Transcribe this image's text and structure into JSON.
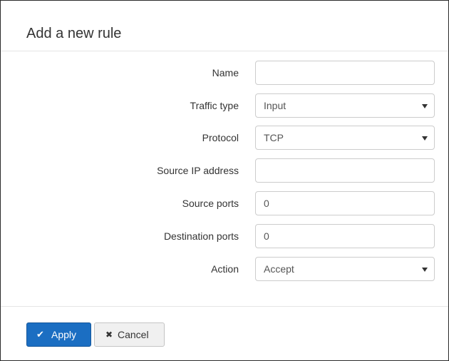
{
  "dialog": {
    "title": "Add a new rule"
  },
  "form": {
    "name": {
      "label": "Name",
      "value": ""
    },
    "traffic_type": {
      "label": "Traffic type",
      "value": "Input"
    },
    "protocol": {
      "label": "Protocol",
      "value": "TCP"
    },
    "source_ip": {
      "label": "Source IP address",
      "value": ""
    },
    "source_ports": {
      "label": "Source ports",
      "value": "0"
    },
    "destination_ports": {
      "label": "Destination ports",
      "value": "0"
    },
    "action": {
      "label": "Action",
      "value": "Accept"
    }
  },
  "footer": {
    "apply_label": "Apply",
    "apply_icon": "checkmark-icon",
    "cancel_label": "Cancel",
    "cancel_icon": "close-icon"
  },
  "colors": {
    "primary_button": "#1b6ec2",
    "default_button": "#f0f0f0",
    "input_border": "#cccccc"
  }
}
